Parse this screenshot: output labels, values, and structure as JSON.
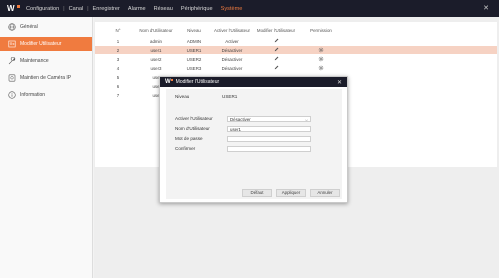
{
  "topbar": {
    "menu": [
      "Configuration",
      "Canal",
      "Enregistrer",
      "Alarme",
      "Réseau",
      "Périphérique",
      "Système"
    ],
    "active_index": 6,
    "accent_color": "#f07b3f",
    "bar_color": "#1b1c2a"
  },
  "sidebar": {
    "items": [
      {
        "label": "Général",
        "icon": "globe-icon"
      },
      {
        "label": "Modifier Utilisateur",
        "icon": "user-card-icon"
      },
      {
        "label": "Maintenance",
        "icon": "wrench-icon"
      },
      {
        "label": "Maintien de Caméra IP",
        "icon": "camera-icon"
      },
      {
        "label": "Information",
        "icon": "info-icon"
      }
    ],
    "active_index": 1
  },
  "table": {
    "headers": [
      "N°",
      "Nom d'Utilisateur",
      "Niveau",
      "Activer l'Utilisateur",
      "Modifier l'Utilisateur",
      "Permission"
    ],
    "rows": [
      {
        "n": "1",
        "name": "admin",
        "level": "ADMIN",
        "status": "Activer",
        "has_perm": false
      },
      {
        "n": "2",
        "name": "user1",
        "level": "USER1",
        "status": "Désactiver",
        "has_perm": true
      },
      {
        "n": "3",
        "name": "user2",
        "level": "USER2",
        "status": "Désactiver",
        "has_perm": true
      },
      {
        "n": "4",
        "name": "user3",
        "level": "USER3",
        "status": "Désactiver",
        "has_perm": true
      },
      {
        "n": "5",
        "name": "use",
        "level": "",
        "status": "",
        "has_perm": false
      },
      {
        "n": "6",
        "name": "use",
        "level": "",
        "status": "",
        "has_perm": false
      },
      {
        "n": "7",
        "name": "use",
        "level": "",
        "status": "",
        "has_perm": false
      }
    ],
    "selected_index": 1,
    "selected_color": "#f6d2c3"
  },
  "modal": {
    "title": "Modifier l'Utilisateur",
    "level_label": "Niveau",
    "level_value": "USER1",
    "enable_label": "Activer l'Utilisateur",
    "enable_value": "Désactiver",
    "username_label": "Nom d'Utilisateur",
    "username_value": "user1",
    "password_label": "Mot de passe",
    "password_value": "",
    "confirm_label": "Confirmer",
    "confirm_value": "",
    "buttons": {
      "default": "Défaut",
      "apply": "Appliquer",
      "cancel": "Annuler"
    }
  }
}
